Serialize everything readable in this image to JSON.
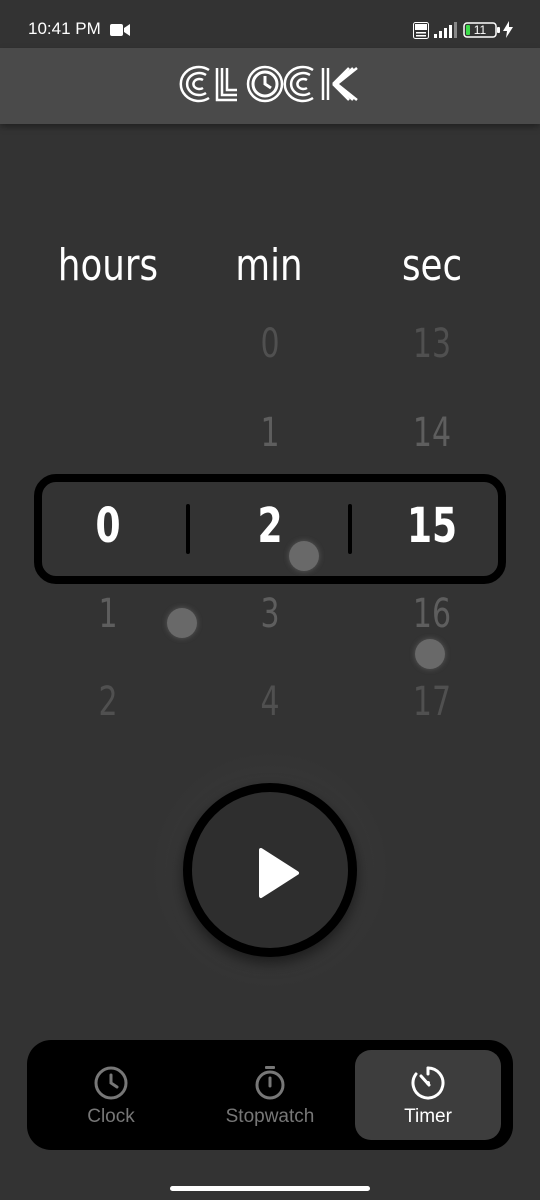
{
  "status_bar": {
    "time": "10:41 PM",
    "battery_level": "11",
    "icons": [
      "video-camera-icon",
      "volte-icon",
      "signal-icon",
      "battery-icon",
      "charging-bolt-icon"
    ]
  },
  "app_bar": {
    "logo_text": "CLOCK"
  },
  "picker": {
    "labels": {
      "hours": "hours",
      "min": "min",
      "sec": "sec"
    },
    "hours": {
      "above2": "",
      "above1": "",
      "selected": "0",
      "below1": "1",
      "below2": "2"
    },
    "minutes": {
      "above2": "0",
      "above1": "1",
      "selected": "2",
      "below1": "3",
      "below2": "4"
    },
    "seconds": {
      "above2": "13",
      "above1": "14",
      "selected": "15",
      "below1": "16",
      "below2": "17"
    }
  },
  "play_button": {
    "icon": "play-icon"
  },
  "bottom_nav": {
    "items": [
      {
        "label": "Clock",
        "icon": "clock-icon",
        "active": false
      },
      {
        "label": "Stopwatch",
        "icon": "stopwatch-icon",
        "active": false
      },
      {
        "label": "Timer",
        "icon": "timer-icon",
        "active": true
      }
    ]
  },
  "colors": {
    "background": "#333333",
    "app_bar": "#4a4a4a",
    "frame": "#000000",
    "active_nav": "#3d3d3d",
    "inactive_text": "#777777",
    "text": "#ffffff"
  }
}
